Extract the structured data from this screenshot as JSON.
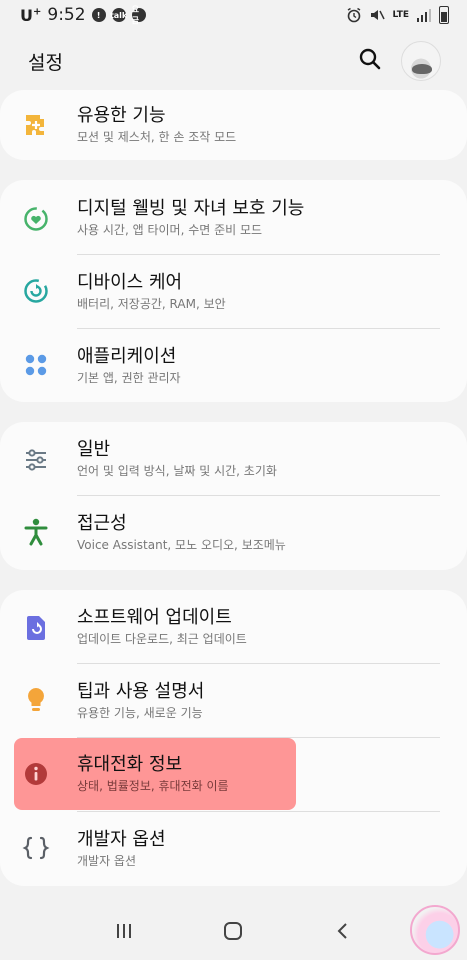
{
  "status": {
    "carrier": "U",
    "carrier_sup": "+",
    "time": "9:52",
    "notif1": "!",
    "notif2": "talk",
    "notif3": "요금",
    "network": "LTE"
  },
  "header": {
    "title": "설정"
  },
  "items": [
    {
      "title": "유용한 기능",
      "sub": "모션 및 제스처, 한 손 조작 모드",
      "icon": "puzzle-plus-icon",
      "color": "#f3b53b"
    },
    {
      "title": "디지털 웰빙 및 자녀 보호 기능",
      "sub": "사용 시간, 앱 타이머, 수면 준비 모드",
      "icon": "wellbeing-heart-icon",
      "color": "#47b36b"
    },
    {
      "title": "디바이스 케어",
      "sub": "배터리, 저장공간, RAM, 보안",
      "icon": "device-care-icon",
      "color": "#27a7a0"
    },
    {
      "title": "애플리케이션",
      "sub": "기본 앱, 권한 관리자",
      "icon": "apps-grid-icon",
      "color": "#5b9ae6"
    },
    {
      "title": "일반",
      "sub": "언어 및 입력 방식, 날짜 및 시간, 초기화",
      "icon": "sliders-icon",
      "color": "#6b7a86"
    },
    {
      "title": "접근성",
      "sub": "Voice Assistant, 모노 오디오, 보조메뉴",
      "icon": "accessibility-person-icon",
      "color": "#2f8d3d"
    },
    {
      "title": "소프트웨어 업데이트",
      "sub": "업데이트 다운로드, 최근 업데이트",
      "icon": "software-update-icon",
      "color": "#6b6fe0"
    },
    {
      "title": "팁과 사용 설명서",
      "sub": "유용한 기능, 새로운 기능",
      "icon": "lightbulb-icon",
      "color": "#f4a53a"
    },
    {
      "title": "휴대전화 정보",
      "sub": "상태, 법률정보, 휴대전화 이름",
      "icon": "info-circle-icon",
      "color": "#8b8f98"
    },
    {
      "title": "개발자 옵션",
      "sub": "개발자 옵션",
      "icon": "curly-braces-icon",
      "color": "#5a5f66"
    }
  ]
}
